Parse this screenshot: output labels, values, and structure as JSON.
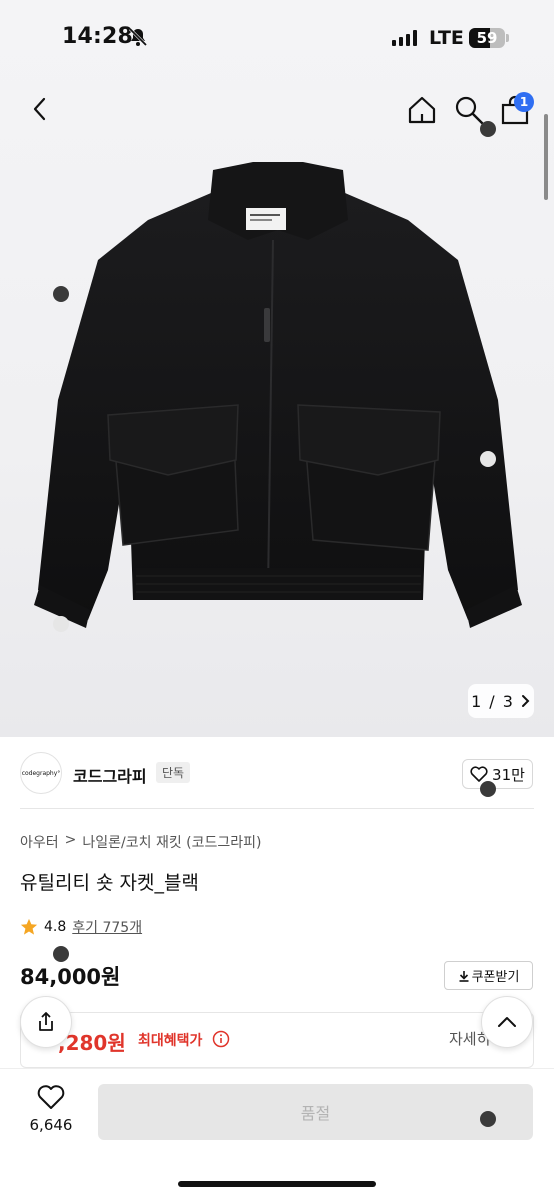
{
  "status_bar": {
    "time": "14:28",
    "network": "LTE",
    "battery": "59",
    "battery_level": 0.59,
    "icons": [
      "bell-slash-icon",
      "signal-icon",
      "battery-icon"
    ]
  },
  "nav": {
    "icons": [
      "chevron-left-icon",
      "home-icon",
      "search-icon",
      "shopping-bag-icon"
    ],
    "cart_badge": "1"
  },
  "gallery": {
    "current": "1",
    "separator": "/",
    "total": "3",
    "next_icon": "chevron-right-icon"
  },
  "brand": {
    "logo_text": "codegraphy°",
    "name": "코드그라피",
    "tag": "단독",
    "likes": "31만"
  },
  "product": {
    "category_main": "아우터",
    "category_sep": ">",
    "category_sub": "나일론/코치 재킷 (코드그라피)",
    "title": "유틸리티 숏 자켓_블랙",
    "rating": "4.8",
    "review_text": "후기 775개",
    "price": "84,000원",
    "coupon_label": "쿠폰받기",
    "benefit_price": ",280원",
    "benefit_label": "최대혜택가",
    "detail_label": "자세히"
  },
  "bottom": {
    "wish_count": "6,646",
    "purchase_label": "품절"
  },
  "colors": {
    "accent_red": "#e0352b",
    "badge_blue": "#2f6ef2"
  }
}
